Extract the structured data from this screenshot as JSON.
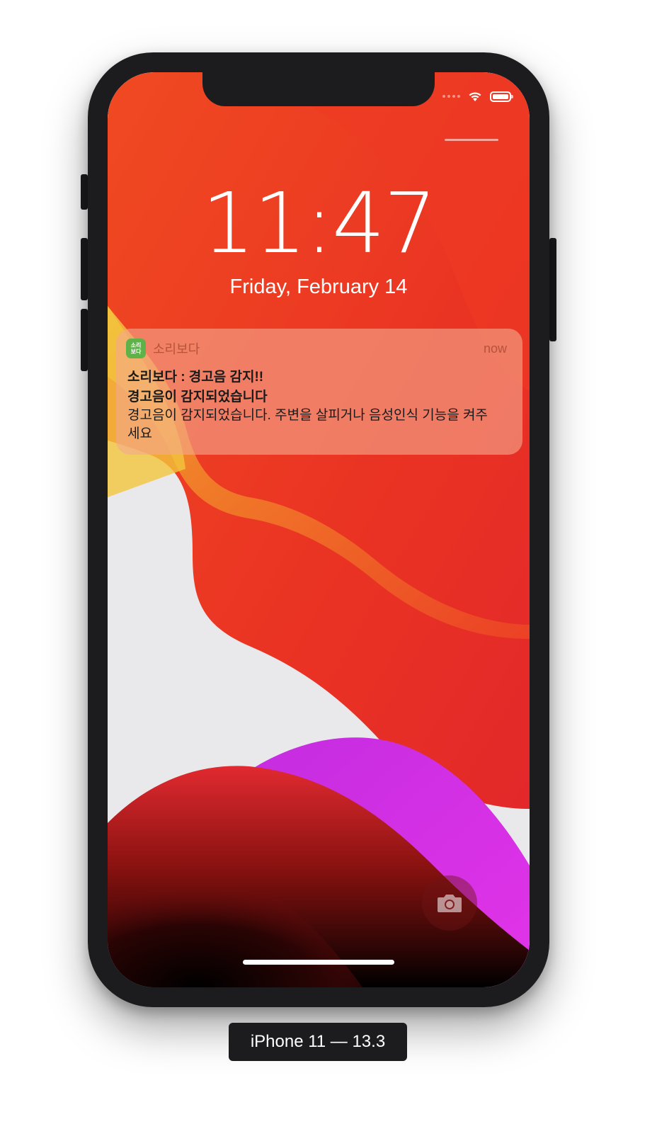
{
  "lock_screen": {
    "time": "11:47",
    "date": "Friday, February 14"
  },
  "status_bar": {
    "icons": [
      "signal-dots-icon",
      "wifi-icon",
      "battery-icon"
    ]
  },
  "notification": {
    "app_icon_text": "소리\n보다",
    "app_name": "소리보다",
    "time": "now",
    "title": "소리보다 : 경고음 감지!!",
    "subtitle": "경고음이 감지되었습니다",
    "body": "경고음이 감지되었습니다. 주변을 살피거나 음성인식 기능을 켜주세요",
    "accent_color": "#5fb248"
  },
  "camera_shortcut": {
    "icon": "camera-icon"
  },
  "device_label": "iPhone 11 — 13.3"
}
